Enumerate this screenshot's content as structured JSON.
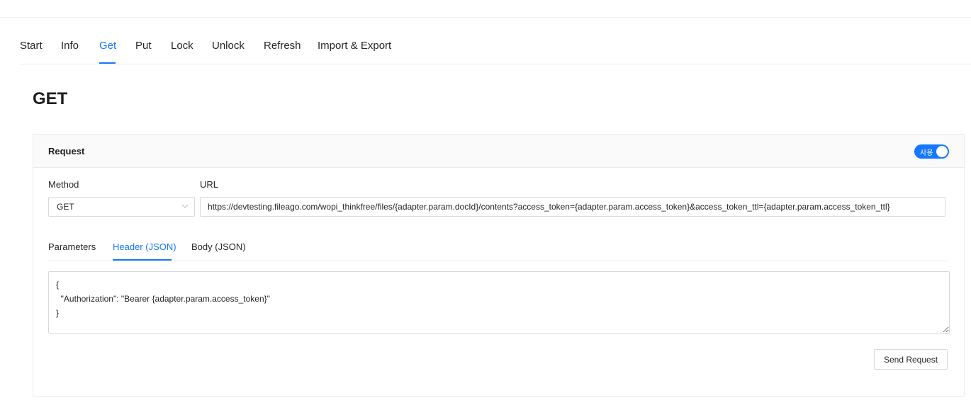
{
  "nav": {
    "tabs": [
      "Start",
      "Info",
      "Get",
      "Put",
      "Lock",
      "Unlock",
      "Refresh",
      "Import & Export"
    ],
    "active": "Get"
  },
  "page": {
    "title": "GET"
  },
  "request": {
    "title": "Request",
    "toggle_label": "사용",
    "toggle_on": true,
    "method_label": "Method",
    "method_value": "GET",
    "url_label": "URL",
    "url_value": "https://devtesting.fileago.com/wopi_thinkfree/files/{adapter.param.docId}/contents?access_token={adapter.param.access_token}&access_token_ttl={adapter.param.access_token_ttl}",
    "subtabs": [
      "Parameters",
      "Header (JSON)",
      "Body (JSON)"
    ],
    "active_subtab": "Header (JSON)",
    "header_json": "{\n  \"Authorization\": \"Bearer {adapter.param.access_token}\"\n}",
    "send_label": "Send Request"
  },
  "colors": {
    "accent": "#1677ff",
    "border": "#d9d9d9",
    "header_bg": "#fafafa"
  },
  "icons": {
    "select_arrow": "chevron-down-icon"
  }
}
